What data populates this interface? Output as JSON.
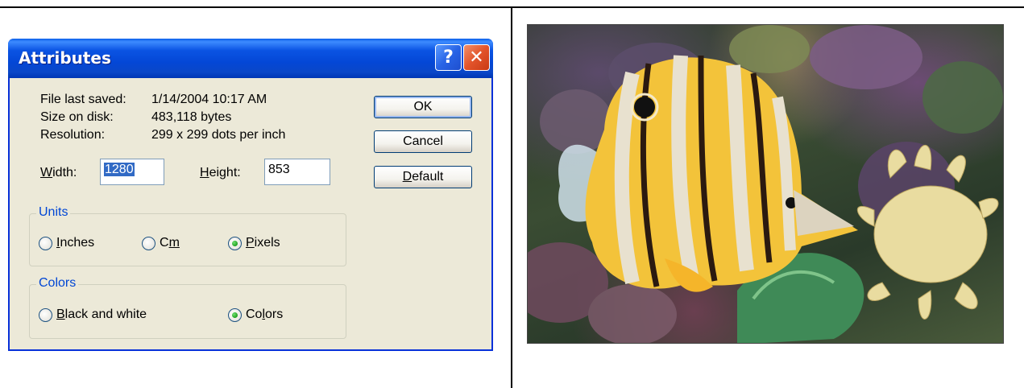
{
  "dialog": {
    "title": "Attributes",
    "help_glyph": "?",
    "close_glyph": "✕",
    "info": {
      "saved_label": "File last saved:",
      "saved_value": "1/14/2004 10:17 AM",
      "size_label": "Size on disk:",
      "size_value": "483,118 bytes",
      "res_label": "Resolution:",
      "res_value": "299 x 299 dots per inch"
    },
    "width": {
      "label_first": "W",
      "label_rest": "idth:",
      "value": "1280"
    },
    "height": {
      "label_first": "H",
      "label_rest": "eight:",
      "value": "853"
    },
    "units": {
      "legend": "Units",
      "inches": {
        "first": "I",
        "rest": "nches"
      },
      "cm": {
        "first": "C",
        "under": "m",
        "rest": ""
      },
      "pixels": {
        "first": "P",
        "rest": "ixels"
      },
      "selected": "pixels"
    },
    "colors": {
      "legend": "Colors",
      "bw": {
        "first": "B",
        "rest": "lack and white"
      },
      "color": {
        "pre": "Co",
        "under": "l",
        "rest": "ors"
      },
      "selected": "colors"
    },
    "buttons": {
      "ok": "OK",
      "cancel": "Cancel",
      "default_first": "D",
      "default_rest": "efault"
    }
  },
  "accent_color": "#0831d9"
}
